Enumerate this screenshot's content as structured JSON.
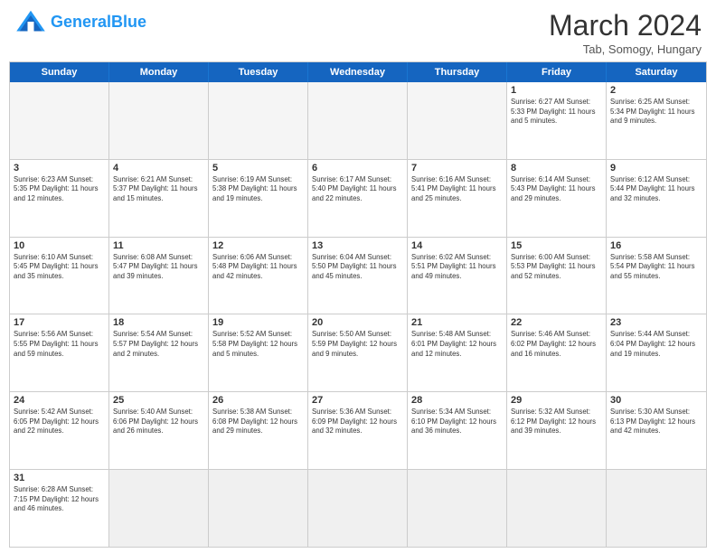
{
  "header": {
    "logo_general": "General",
    "logo_blue": "Blue",
    "title": "March 2024",
    "subtitle": "Tab, Somogy, Hungary"
  },
  "calendar": {
    "days": [
      "Sunday",
      "Monday",
      "Tuesday",
      "Wednesday",
      "Thursday",
      "Friday",
      "Saturday"
    ],
    "rows": [
      [
        {
          "day": "",
          "info": "",
          "empty": true
        },
        {
          "day": "",
          "info": "",
          "empty": true
        },
        {
          "day": "",
          "info": "",
          "empty": true
        },
        {
          "day": "",
          "info": "",
          "empty": true
        },
        {
          "day": "",
          "info": "",
          "empty": true
        },
        {
          "day": "1",
          "info": "Sunrise: 6:27 AM\nSunset: 5:33 PM\nDaylight: 11 hours\nand 5 minutes."
        },
        {
          "day": "2",
          "info": "Sunrise: 6:25 AM\nSunset: 5:34 PM\nDaylight: 11 hours\nand 9 minutes."
        }
      ],
      [
        {
          "day": "3",
          "info": "Sunrise: 6:23 AM\nSunset: 5:35 PM\nDaylight: 11 hours\nand 12 minutes."
        },
        {
          "day": "4",
          "info": "Sunrise: 6:21 AM\nSunset: 5:37 PM\nDaylight: 11 hours\nand 15 minutes."
        },
        {
          "day": "5",
          "info": "Sunrise: 6:19 AM\nSunset: 5:38 PM\nDaylight: 11 hours\nand 19 minutes."
        },
        {
          "day": "6",
          "info": "Sunrise: 6:17 AM\nSunset: 5:40 PM\nDaylight: 11 hours\nand 22 minutes."
        },
        {
          "day": "7",
          "info": "Sunrise: 6:16 AM\nSunset: 5:41 PM\nDaylight: 11 hours\nand 25 minutes."
        },
        {
          "day": "8",
          "info": "Sunrise: 6:14 AM\nSunset: 5:43 PM\nDaylight: 11 hours\nand 29 minutes."
        },
        {
          "day": "9",
          "info": "Sunrise: 6:12 AM\nSunset: 5:44 PM\nDaylight: 11 hours\nand 32 minutes."
        }
      ],
      [
        {
          "day": "10",
          "info": "Sunrise: 6:10 AM\nSunset: 5:45 PM\nDaylight: 11 hours\nand 35 minutes."
        },
        {
          "day": "11",
          "info": "Sunrise: 6:08 AM\nSunset: 5:47 PM\nDaylight: 11 hours\nand 39 minutes."
        },
        {
          "day": "12",
          "info": "Sunrise: 6:06 AM\nSunset: 5:48 PM\nDaylight: 11 hours\nand 42 minutes."
        },
        {
          "day": "13",
          "info": "Sunrise: 6:04 AM\nSunset: 5:50 PM\nDaylight: 11 hours\nand 45 minutes."
        },
        {
          "day": "14",
          "info": "Sunrise: 6:02 AM\nSunset: 5:51 PM\nDaylight: 11 hours\nand 49 minutes."
        },
        {
          "day": "15",
          "info": "Sunrise: 6:00 AM\nSunset: 5:53 PM\nDaylight: 11 hours\nand 52 minutes."
        },
        {
          "day": "16",
          "info": "Sunrise: 5:58 AM\nSunset: 5:54 PM\nDaylight: 11 hours\nand 55 minutes."
        }
      ],
      [
        {
          "day": "17",
          "info": "Sunrise: 5:56 AM\nSunset: 5:55 PM\nDaylight: 11 hours\nand 59 minutes."
        },
        {
          "day": "18",
          "info": "Sunrise: 5:54 AM\nSunset: 5:57 PM\nDaylight: 12 hours\nand 2 minutes."
        },
        {
          "day": "19",
          "info": "Sunrise: 5:52 AM\nSunset: 5:58 PM\nDaylight: 12 hours\nand 5 minutes."
        },
        {
          "day": "20",
          "info": "Sunrise: 5:50 AM\nSunset: 5:59 PM\nDaylight: 12 hours\nand 9 minutes."
        },
        {
          "day": "21",
          "info": "Sunrise: 5:48 AM\nSunset: 6:01 PM\nDaylight: 12 hours\nand 12 minutes."
        },
        {
          "day": "22",
          "info": "Sunrise: 5:46 AM\nSunset: 6:02 PM\nDaylight: 12 hours\nand 16 minutes."
        },
        {
          "day": "23",
          "info": "Sunrise: 5:44 AM\nSunset: 6:04 PM\nDaylight: 12 hours\nand 19 minutes."
        }
      ],
      [
        {
          "day": "24",
          "info": "Sunrise: 5:42 AM\nSunset: 6:05 PM\nDaylight: 12 hours\nand 22 minutes."
        },
        {
          "day": "25",
          "info": "Sunrise: 5:40 AM\nSunset: 6:06 PM\nDaylight: 12 hours\nand 26 minutes."
        },
        {
          "day": "26",
          "info": "Sunrise: 5:38 AM\nSunset: 6:08 PM\nDaylight: 12 hours\nand 29 minutes."
        },
        {
          "day": "27",
          "info": "Sunrise: 5:36 AM\nSunset: 6:09 PM\nDaylight: 12 hours\nand 32 minutes."
        },
        {
          "day": "28",
          "info": "Sunrise: 5:34 AM\nSunset: 6:10 PM\nDaylight: 12 hours\nand 36 minutes."
        },
        {
          "day": "29",
          "info": "Sunrise: 5:32 AM\nSunset: 6:12 PM\nDaylight: 12 hours\nand 39 minutes."
        },
        {
          "day": "30",
          "info": "Sunrise: 5:30 AM\nSunset: 6:13 PM\nDaylight: 12 hours\nand 42 minutes."
        }
      ],
      [
        {
          "day": "31",
          "info": "Sunrise: 6:28 AM\nSunset: 7:15 PM\nDaylight: 12 hours\nand 46 minutes."
        },
        {
          "day": "",
          "info": "",
          "empty": true
        },
        {
          "day": "",
          "info": "",
          "empty": true
        },
        {
          "day": "",
          "info": "",
          "empty": true
        },
        {
          "day": "",
          "info": "",
          "empty": true
        },
        {
          "day": "",
          "info": "",
          "empty": true
        },
        {
          "day": "",
          "info": "",
          "empty": true
        }
      ]
    ]
  }
}
